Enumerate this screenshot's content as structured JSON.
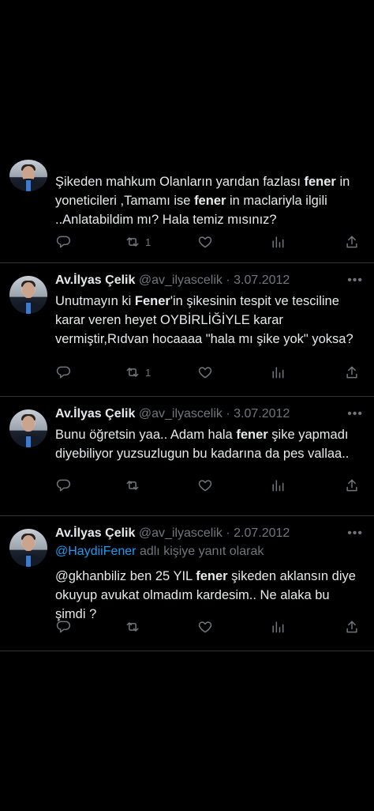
{
  "tweets": [
    {
      "name": "",
      "handle": "",
      "date": "",
      "reply_prefix": "",
      "reply_to": "",
      "reply_suffix": "",
      "segments": [
        {
          "t": "Şikeden mahkum Olanların yarıdan fazlası ",
          "b": false
        },
        {
          "t": "fener",
          "b": true
        },
        {
          "t": " in yoneticileri ,Tamamı ise ",
          "b": false
        },
        {
          "t": "fener",
          "b": true
        },
        {
          "t": " in maclariyla ilgili ..Anlatabildim mı? Hala temiz mısınız?",
          "b": false
        }
      ],
      "retweets": "1"
    },
    {
      "name": "Av.İlyas Çelik",
      "handle": "@av_ilyascelik",
      "date": "· 3.07.2012",
      "reply_prefix": "",
      "reply_to": "",
      "reply_suffix": "",
      "segments": [
        {
          "t": "Unutmayın ki ",
          "b": false
        },
        {
          "t": "Fener",
          "b": true
        },
        {
          "t": "'in şikesinin tespit ve tesciline karar veren heyet OYBİRLİĞİYLE karar vermiştir,Rıdvan hocaaaa \"hala mı şike yok\" yoksa?",
          "b": false
        }
      ],
      "retweets": "1"
    },
    {
      "name": "Av.İlyas Çelik",
      "handle": "@av_ilyascelik",
      "date": "· 3.07.2012",
      "reply_prefix": "",
      "reply_to": "",
      "reply_suffix": "",
      "segments": [
        {
          "t": "Bunu öğretsin yaa.. Adam hala ",
          "b": false
        },
        {
          "t": "fener",
          "b": true
        },
        {
          "t": " şike yapmadı diyebiliyor yuzsuzlugun bu kadarına da pes vallaa..",
          "b": false
        }
      ],
      "retweets": ""
    },
    {
      "name": "Av.İlyas Çelik",
      "handle": "@av_ilyascelik",
      "date": "· 2.07.2012",
      "reply_prefix": "",
      "reply_to": "@HaydiiFener",
      "reply_suffix": " adlı kişiye yanıt olarak",
      "segments": [
        {
          "t": "@gkhanbiliz ben 25 YIL ",
          "b": false
        },
        {
          "t": "fener",
          "b": true
        },
        {
          "t": " şikeden aklansın diye okuyup avukat olmadım kardesim.. Ne alaka bu şimdi ?",
          "b": false
        }
      ],
      "retweets": ""
    }
  ],
  "icons": {
    "reply": "reply-icon",
    "retweet": "retweet-icon",
    "like": "heart-icon",
    "views": "views-icon",
    "share": "share-icon",
    "more": "more-icon"
  },
  "colors": {
    "background": "#000000",
    "text": "#e7e9ea",
    "secondary": "#71767b",
    "link": "#1d9bf0",
    "divider": "#2f3336"
  }
}
